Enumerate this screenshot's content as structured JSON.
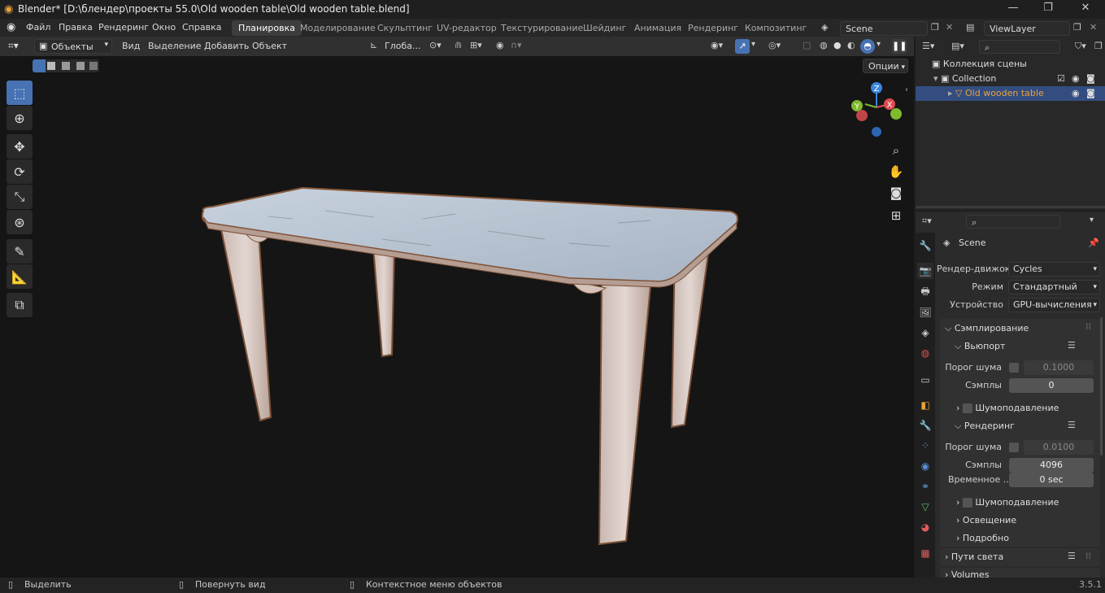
{
  "window": {
    "title": "Blender* [D:\\блендер\\проекты 55.0\\Old wooden table\\Old wooden table.blend]",
    "minimize": "—",
    "maximize": "❐",
    "close": "✕"
  },
  "menu": [
    "Файл",
    "Правка",
    "Рендеринг",
    "Окно",
    "Справка"
  ],
  "workspaces": [
    {
      "label": "Планировка",
      "active": true
    },
    {
      "label": "Моделирование"
    },
    {
      "label": "Скульптинг"
    },
    {
      "label": "UV-редактор"
    },
    {
      "label": "Текстурирование"
    },
    {
      "label": "Шейдинг"
    },
    {
      "label": "Анимация"
    },
    {
      "label": "Рендеринг"
    },
    {
      "label": "Композитинг"
    }
  ],
  "scene_name": "Scene",
  "view_layer": "ViewLayer",
  "viewport_header": {
    "mode": "Объекты",
    "menus": [
      "Вид",
      "Выделение",
      "Добавить",
      "Объект"
    ],
    "transform_orientation": "Глоба...",
    "options": "Опции"
  },
  "gizmo": {
    "x": "X",
    "y": "Y",
    "z": "Z"
  },
  "outliner": {
    "root": "Коллекция сцены",
    "collection": "Collection",
    "object": "Old wooden table"
  },
  "properties": {
    "context": "Scene",
    "render_engine_label": "Рендер-движок",
    "render_engine": "Cycles",
    "mode_label": "Режим",
    "mode": "Стандартный",
    "device_label": "Устройство",
    "device": "GPU-вычисления",
    "sampling": "Сэмплирование",
    "viewport": "Вьюпорт",
    "noise_threshold_label": "Порог шума",
    "viewport_noise_threshold": "0.1000",
    "samples_label": "Сэмплы",
    "viewport_samples": "0",
    "denoise": "Шумоподавление",
    "render": "Рендеринг",
    "render_noise_threshold": "0.0100",
    "render_samples": "4096",
    "time_label": "Временное ...",
    "time_value": "0 sec",
    "lighting": "Освещение",
    "advanced": "Подробно",
    "light_paths": "Пути света",
    "volumes": "Volumes"
  },
  "status": {
    "select": "Выделить",
    "rotate": "Повернуть вид",
    "context_menu": "Контекстное меню объектов",
    "version": "3.5.1"
  },
  "colors": {
    "accent": "#4772b3",
    "object_orange": "#e8a33c",
    "table_top": "#b8c4d2",
    "table_leg": "#d8c8c2",
    "gizmo_x": "#e04a52",
    "gizmo_y": "#7fba2f",
    "gizmo_z": "#3a86e0"
  }
}
